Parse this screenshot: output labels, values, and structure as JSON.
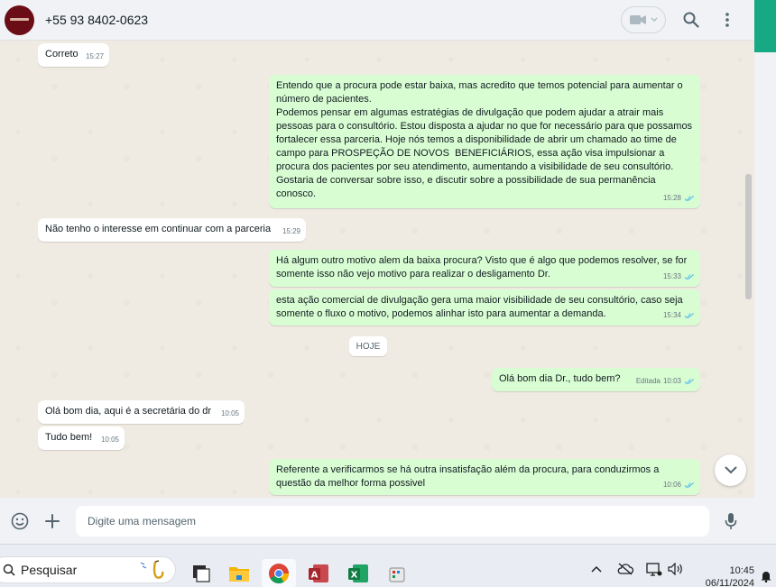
{
  "header": {
    "contact_name": "+55 93 8402-0623"
  },
  "messages": [
    {
      "dir": "in",
      "text": "Correto",
      "time": "15:27"
    },
    {
      "dir": "out",
      "text": "Entendo que a procura pode estar baixa, mas acredito que temos potencial para aumentar o número de pacientes.\nPodemos pensar em algumas estratégias de divulgação que podem ajudar a atrair mais pessoas para o consultório. Estou disposta a ajudar no que for necessário para que possamos fortalecer essa parceria. Hoje nós temos a disponibilidade de abrir um chamado ao time de campo para PROSPEÇÃO DE NOVOS  BENEFICIÁRIOS, essa ação visa impulsionar a procura dos pacientes por seu atendimento, aumentando a visibilidade de seu consultório. Gostaria de conversar sobre isso, e discutir sobre a possibilidade de sua permanência conosco.",
      "time": "15:28"
    },
    {
      "dir": "in",
      "text": "Não tenho o interesse em continuar com a parceria",
      "time": "15:29"
    },
    {
      "dir": "out",
      "text": "Há algum outro motivo alem da baixa procura? Visto que é algo que podemos resolver, se for somente isso não vejo motivo para realizar o desligamento Dr.",
      "time": "15:33"
    },
    {
      "dir": "out",
      "text": "esta ação comercial de divulgação gera uma maior visibilidade de seu consultório, caso seja somente o fluxo o motivo, podemos alinhar isto para aumentar a demanda.",
      "time": "15:34"
    },
    {
      "dir": "out",
      "text": "Olá bom dia Dr., tudo bem?",
      "time": "10:03",
      "edited": "Editada"
    },
    {
      "dir": "in",
      "text": "Olá bom dia, aqui é a secretária do dr",
      "time": "10:05"
    },
    {
      "dir": "in",
      "text": "Tudo bem!",
      "time": "10:05"
    },
    {
      "dir": "out",
      "text": "Referente a verificarmos se há outra insatisfação além da procura, para conduzirmos a questão da melhor forma possivel",
      "time": "10:06"
    }
  ],
  "day_separator": "HOJE",
  "composer": {
    "placeholder": "Digite uma mensagem"
  },
  "taskbar": {
    "search_label": "Pesquisar",
    "time": "10:45",
    "date": "06/11/2024"
  },
  "colors": {
    "incoming_bubble": "#ffffff",
    "outgoing_bubble": "#d9fdd3",
    "chat_background": "#efeae2",
    "read_ticks": "#53bdeb",
    "brand_green": "#17a884"
  },
  "icons": {
    "header": [
      "video-call-icon",
      "search-icon",
      "menu-icon"
    ],
    "composer": [
      "emoji-icon",
      "attach-plus-icon",
      "mic-icon"
    ]
  }
}
